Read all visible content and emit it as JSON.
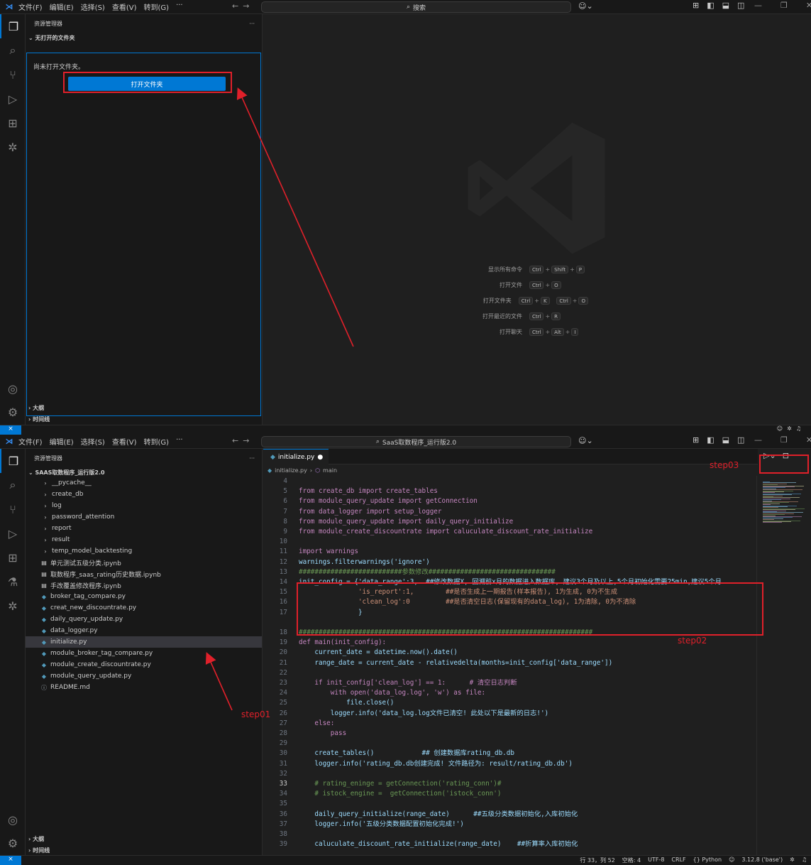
{
  "pane1": {
    "menu": [
      "文件(F)",
      "编辑(E)",
      "选择(S)",
      "查看(V)",
      "转到(G)",
      "···"
    ],
    "search_label": "搜索",
    "explorer_title": "资源管理器",
    "explorer_more": "···",
    "no_folder_section": "无打开的文件夹",
    "no_folder_msg": "尚未打开文件夹。",
    "open_folder_button": "打开文件夹",
    "outline": "大纲",
    "timeline": "时间线",
    "shortcuts": [
      {
        "label": "显示所有命令",
        "keys": [
          [
            "Ctrl",
            "Shift",
            "P"
          ]
        ]
      },
      {
        "label": "打开文件",
        "keys": [
          [
            "Ctrl",
            "O"
          ]
        ]
      },
      {
        "label": "打开文件夹",
        "keys": [
          [
            "Ctrl",
            "K"
          ],
          [
            "Ctrl",
            "O"
          ]
        ]
      },
      {
        "label": "打开最近的文件",
        "keys": [
          [
            "Ctrl",
            "R"
          ]
        ]
      },
      {
        "label": "打开聊天",
        "keys": [
          [
            "Ctrl",
            "Alt",
            "I"
          ]
        ]
      }
    ]
  },
  "pane2": {
    "menu": [
      "文件(F)",
      "编辑(E)",
      "选择(S)",
      "查看(V)",
      "转到(G)",
      "···"
    ],
    "search_label": "SaaS取数程序_运行版2.0",
    "explorer_title": "资源管理器",
    "explorer_more": "···",
    "project_folder": "SAAS取数程序_运行版2.0",
    "tree": [
      {
        "name": "__pycache__",
        "type": "folder"
      },
      {
        "name": "create_db",
        "type": "folder"
      },
      {
        "name": "log",
        "type": "folder"
      },
      {
        "name": "password_attention",
        "type": "folder"
      },
      {
        "name": "report",
        "type": "folder"
      },
      {
        "name": "result",
        "type": "folder"
      },
      {
        "name": "temp_model_backtesting",
        "type": "folder"
      },
      {
        "name": "单元测试五级分类.ipynb",
        "type": "notebook"
      },
      {
        "name": "取数程序_saas_rating历史数据.ipynb",
        "type": "notebook"
      },
      {
        "name": "手改覆盖修改程序.ipynb",
        "type": "notebook"
      },
      {
        "name": "broker_tag_compare.py",
        "type": "python"
      },
      {
        "name": "creat_new_discountrate.py",
        "type": "python"
      },
      {
        "name": "daily_query_update.py",
        "type": "python"
      },
      {
        "name": "data_logger.py",
        "type": "python"
      },
      {
        "name": "initialize.py",
        "type": "python",
        "selected": true
      },
      {
        "name": "module_broker_tag_compare.py",
        "type": "python"
      },
      {
        "name": "module_create_discountrate.py",
        "type": "python"
      },
      {
        "name": "module_query_update.py",
        "type": "python"
      },
      {
        "name": "README.md",
        "type": "info"
      }
    ],
    "outline": "大纲",
    "timeline": "时间线",
    "tab_label": "initialize.py",
    "breadcrumb_file": "initialize.py",
    "breadcrumb_symbol": "main",
    "code_lines": [
      {
        "n": "4",
        "t": ""
      },
      {
        "n": "5",
        "t": "from create_db import create_tables"
      },
      {
        "n": "6",
        "t": "from module_query_update import getConnection"
      },
      {
        "n": "7",
        "t": "from data_logger import setup_logger"
      },
      {
        "n": "8",
        "t": "from module_query_update import daily_query_initialize"
      },
      {
        "n": "9",
        "t": "from module_create_discountrate import caluculate_discount_rate_initialize"
      },
      {
        "n": "10",
        "t": ""
      },
      {
        "n": "11",
        "t": "import warnings"
      },
      {
        "n": "12",
        "t": "warnings.filterwarnings('ignore')"
      },
      {
        "n": "13",
        "t": "##########################参数修改################################"
      },
      {
        "n": "14",
        "t": "init_config = {'data_range':3,  ##修改数据X, 回溯前x月的数据进入数据库, 建议3个月及以上,5个月初始化需要25min,建议5个月"
      },
      {
        "n": "15",
        "t": "               'is_report':1,        ##是否生成上一期报告(样本报告), 1为生成, 0为不生成"
      },
      {
        "n": "16",
        "t": "               'clean_log':0         ##是否清空日志(保留现有的data_log), 1为清除, 0为不清除"
      },
      {
        "n": "17",
        "t": "               }"
      },
      {
        "n": "",
        "t": "   "
      },
      {
        "n": "18",
        "t": "##########################################################################"
      },
      {
        "n": "19",
        "t": "def main(init_config):"
      },
      {
        "n": "20",
        "t": "    current_date = datetime.now().date()"
      },
      {
        "n": "21",
        "t": "    range_date = current_date - relativedelta(months=init_config['data_range'])"
      },
      {
        "n": "22",
        "t": ""
      },
      {
        "n": "23",
        "t": "    if init_config['clean_log'] == 1:      # 清空日志判断"
      },
      {
        "n": "24",
        "t": "        with open('data_log.log', 'w') as file:"
      },
      {
        "n": "25",
        "t": "            file.close()"
      },
      {
        "n": "26",
        "t": "        logger.info('data_log.log文件已清空! 此处以下是最新的日志!')"
      },
      {
        "n": "27",
        "t": "    else:"
      },
      {
        "n": "28",
        "t": "        pass"
      },
      {
        "n": "29",
        "t": ""
      },
      {
        "n": "30",
        "t": "    create_tables()            ## 创建数据库rating_db.db"
      },
      {
        "n": "31",
        "t": "    logger.info('rating_db.db创建完成! 文件路径为: result/rating_db.db')"
      },
      {
        "n": "32",
        "t": ""
      },
      {
        "n": "33",
        "t": "    # rating_eninge = getConnection('rating_conn')#"
      },
      {
        "n": "34",
        "t": "    # istock_engine =  getConnection('istock_conn')"
      },
      {
        "n": "35",
        "t": ""
      },
      {
        "n": "36",
        "t": "    daily_query_initialize(range_date)      ##五级分类数据初始化,入库初始化"
      },
      {
        "n": "37",
        "t": "    logger.info('五级分类数据配置初始化完成!')"
      },
      {
        "n": "38",
        "t": ""
      },
      {
        "n": "39",
        "t": "    caluculate_discount_rate_initialize(range_date)    ##折算率入库初始化"
      }
    ],
    "status": {
      "position": "行 33，列 52",
      "spaces": "空格: 4",
      "encoding": "UTF-8",
      "eol": "CRLF",
      "language": "{} Python",
      "interpreter": "3.12.8 ('base')"
    },
    "steps": {
      "step01": "step01",
      "step02": "step02",
      "step03": "step03"
    }
  },
  "colors": {
    "accent": "#0078d4",
    "annotation_red": "#e0202a"
  }
}
